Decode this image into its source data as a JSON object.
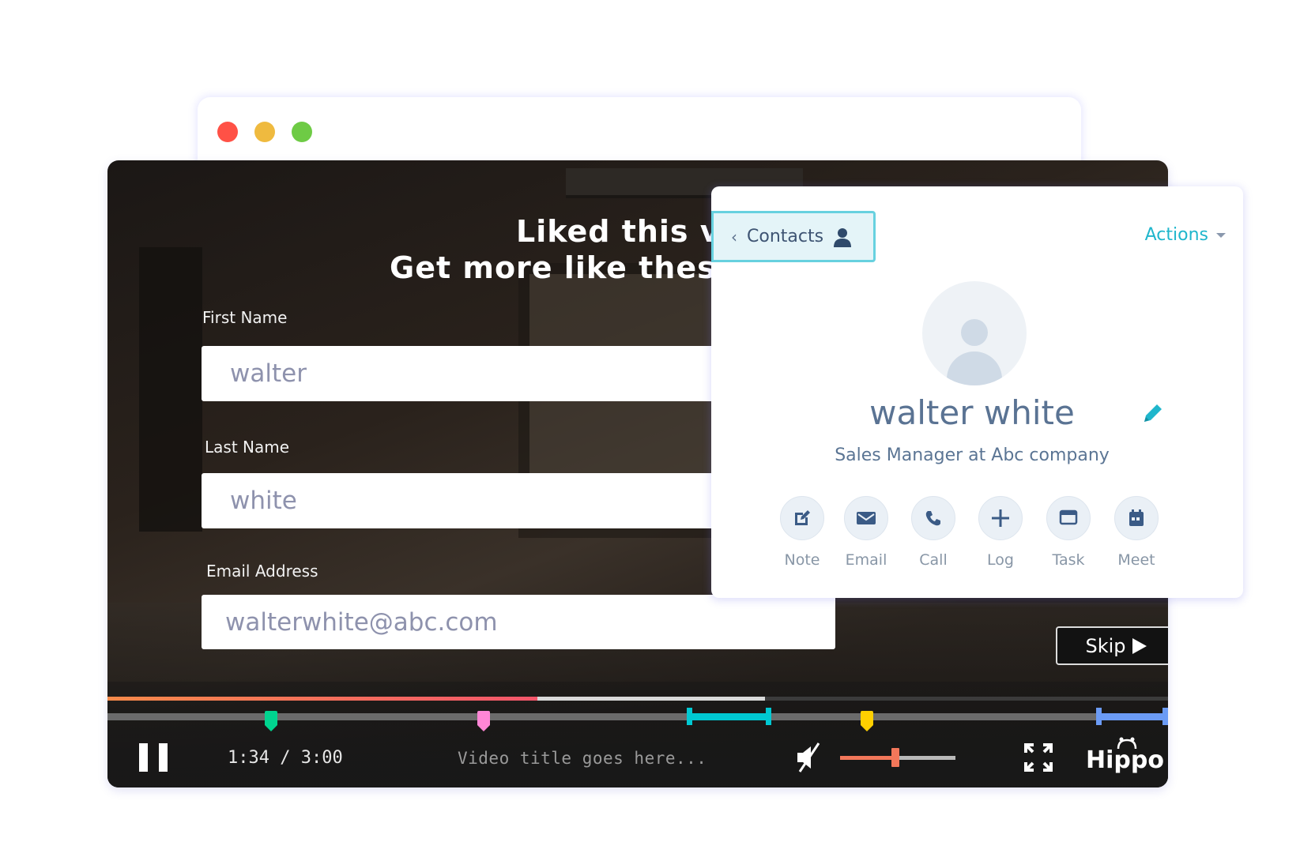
{
  "browser": {
    "window_controls": [
      {
        "name": "close",
        "color": "#ff5146"
      },
      {
        "name": "minimize",
        "color": "#efba3f"
      },
      {
        "name": "maximize",
        "color": "#6ecb45"
      }
    ]
  },
  "video": {
    "headline_line1": "Liked this vid",
    "headline_line2": "Get more like these i",
    "form": {
      "first_name": {
        "label": "First Name",
        "value": "walter"
      },
      "last_name": {
        "label": "Last Name",
        "value": "white"
      },
      "email": {
        "label": "Email Address",
        "value": "walterwhite@abc.com"
      }
    },
    "skip_label": "Skip",
    "controls": {
      "current_time": "1:34",
      "duration": "3:00",
      "time_display": "1:34 / 3:00",
      "played_fraction": 0.405,
      "buffered_fraction": 0.62,
      "title": "Video title goes here...",
      "volume_fraction": 0.48,
      "muted": true,
      "logo_text": "Hippo",
      "colors": {
        "played_start": "#f58a4a",
        "played_end": "#f2566b",
        "volume": "#f2775a"
      },
      "markers": [
        {
          "type": "pin",
          "position": 0.154,
          "color": "#00d48f"
        },
        {
          "type": "pin",
          "position": 0.355,
          "color": "#ff86d6"
        },
        {
          "type": "range",
          "start": 0.546,
          "end": 0.626,
          "color": "#00c8d2"
        },
        {
          "type": "pin",
          "position": 0.716,
          "color": "#ffd000"
        },
        {
          "type": "range",
          "start": 0.932,
          "end": 1.0,
          "color": "#6b9bf5"
        }
      ]
    }
  },
  "contact_card": {
    "tab_label": "Contacts",
    "actions_label": "Actions",
    "name": "walter white",
    "title": "Sales Manager at Abc company",
    "accent_color": "#1fb6cc",
    "actions": [
      {
        "label": "Note",
        "icon": "note-edit-icon"
      },
      {
        "label": "Email",
        "icon": "email-icon"
      },
      {
        "label": "Call",
        "icon": "phone-icon"
      },
      {
        "label": "Log",
        "icon": "plus-icon"
      },
      {
        "label": "Task",
        "icon": "task-icon"
      },
      {
        "label": "Meet",
        "icon": "calendar-icon"
      }
    ]
  }
}
